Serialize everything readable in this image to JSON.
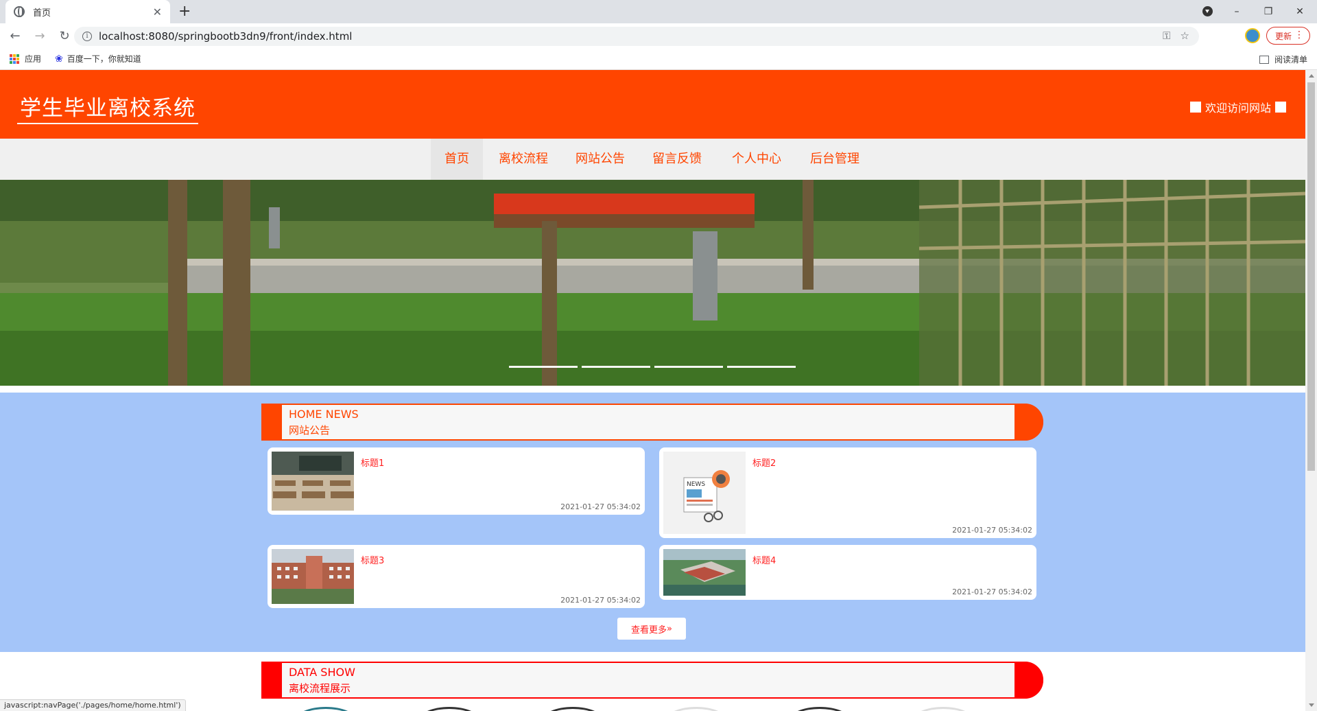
{
  "browser": {
    "tab_title": "首页",
    "url": "localhost:8080/springbootb3dn9/front/index.html",
    "update_label": "更新",
    "bookmarks": [
      {
        "label": "应用"
      },
      {
        "label": "百度一下，你就知道"
      }
    ],
    "reading_list": "阅读清单",
    "status_url": "javascript:navPage('./pages/home/home.html')"
  },
  "header": {
    "site_title": "学生毕业离校系统",
    "welcome": "欢迎访问网站"
  },
  "nav": {
    "items": [
      {
        "label": "首页"
      },
      {
        "label": "离校流程"
      },
      {
        "label": "网站公告"
      },
      {
        "label": "留言反馈"
      },
      {
        "label": "个人中心"
      },
      {
        "label": "后台管理"
      }
    ]
  },
  "news": {
    "title_en": "HOME NEWS",
    "title_cn": "网站公告",
    "items": [
      {
        "title": "标题1",
        "date": "2021-01-27 05:34:02"
      },
      {
        "title": "标题2",
        "date": "2021-01-27 05:34:02"
      },
      {
        "title": "标题3",
        "date": "2021-01-27 05:34:02"
      },
      {
        "title": "标题4",
        "date": "2021-01-27 05:34:02"
      }
    ],
    "more_label": "查看更多",
    "more_icon": "double-chevron-right-icon"
  },
  "data_show": {
    "title_en": "DATA SHOW",
    "title_cn": "离校流程展示"
  },
  "colors": {
    "brand": "#ff4500",
    "section_bg": "#a4c5f9",
    "title_red": "#ff2020"
  }
}
